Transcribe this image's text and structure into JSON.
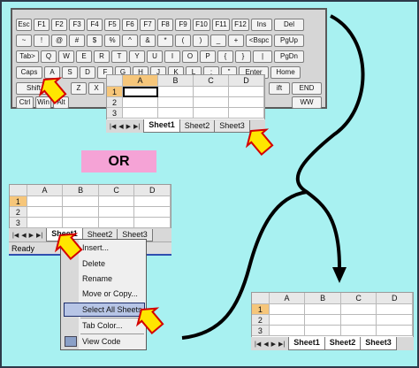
{
  "keyboard": {
    "row1": [
      "Esc",
      "F1",
      "F2",
      "F3",
      "F4",
      "F5",
      "F6",
      "F7",
      "F8",
      "F9",
      "F10",
      "F11",
      "F12",
      "Ins",
      "Del"
    ],
    "row2": [
      "~",
      "!",
      "@",
      "#",
      "$",
      "%",
      "^",
      "&",
      "*",
      "(",
      ")",
      "_",
      "+",
      "<Bspc",
      "PgUp"
    ],
    "row3": [
      "Tab>",
      "Q",
      "W",
      "E",
      "R",
      "T",
      "Y",
      "U",
      "I",
      "O",
      "P",
      "{",
      "}",
      "|",
      "PgDn"
    ],
    "row4": [
      "Caps",
      "A",
      "S",
      "D",
      "F",
      "G",
      "H",
      "J",
      "K",
      "L",
      ":",
      "\"",
      "Enter",
      "Home"
    ],
    "row5": [
      "Shift",
      "Z",
      "X",
      "ift",
      "END"
    ],
    "row6": [
      "Ctrl",
      "Win",
      "Alt",
      "WW"
    ]
  },
  "top_sheet": {
    "columns": [
      "A",
      "B",
      "C",
      "D"
    ],
    "rows": [
      "1",
      "2",
      "3"
    ],
    "tabs": [
      "Sheet1",
      "Sheet2",
      "Sheet3"
    ]
  },
  "or_label": "OR",
  "left_sheet": {
    "columns": [
      "A",
      "B",
      "C",
      "D"
    ],
    "rows": [
      "1",
      "2",
      "3"
    ],
    "tabs": [
      "Sheet1",
      "Sheet2",
      "Sheet3"
    ],
    "status": "Ready"
  },
  "context_menu": {
    "items": [
      "Insert...",
      "Delete",
      "Rename",
      "Move or Copy...",
      "Select All Sheets",
      "Tab Color...",
      "View Code"
    ]
  },
  "right_sheet": {
    "columns": [
      "A",
      "B",
      "C",
      "D"
    ],
    "rows": [
      "1",
      "2",
      "3"
    ],
    "tabs": [
      "Sheet1",
      "Sheet2",
      "Sheet3"
    ]
  },
  "colors": {
    "background": "#a8f1f1",
    "arrow_fill": "#ffe600",
    "arrow_stroke": "#d40000",
    "selected_header": "#f6c67a",
    "or_box": "#f5a3d6"
  }
}
